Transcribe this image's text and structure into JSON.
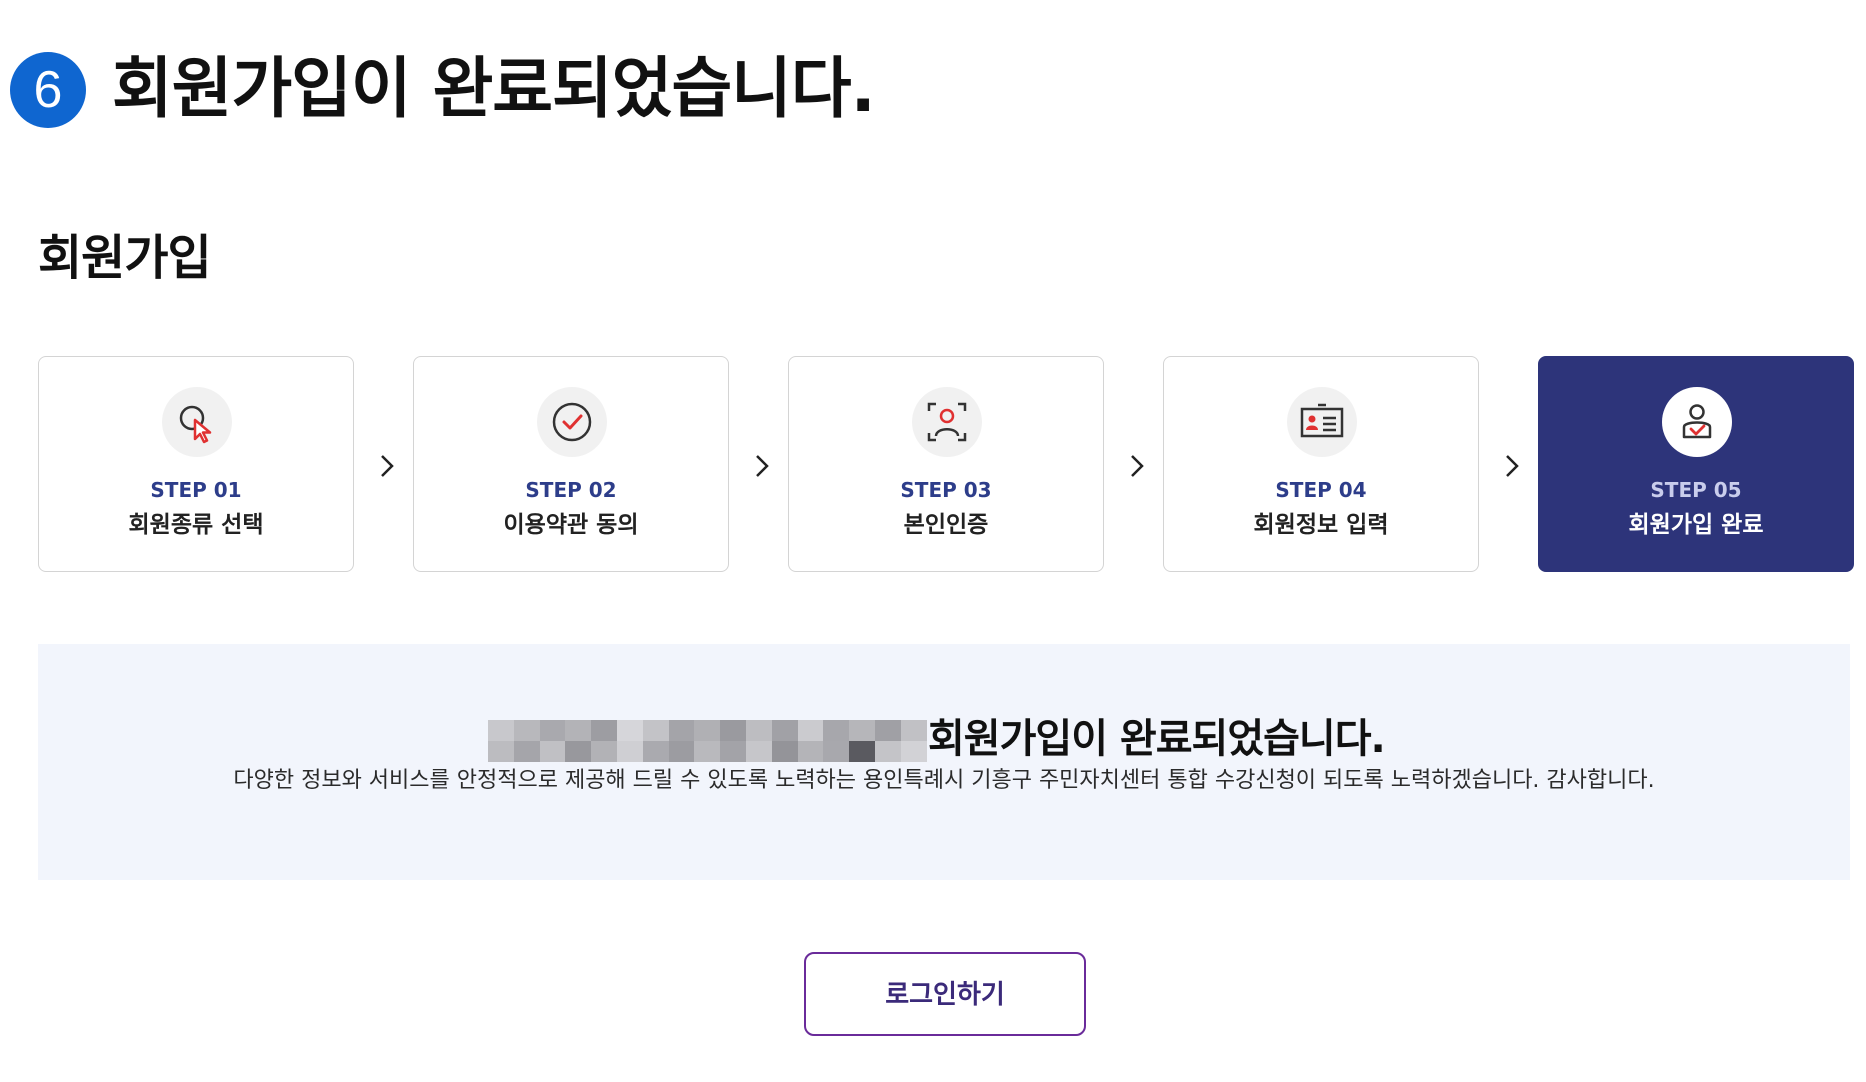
{
  "header": {
    "step_badge": "6",
    "title": "회원가입이 완료되었습니다."
  },
  "section": {
    "title": "회원가입"
  },
  "steps": [
    {
      "number": "STEP 01",
      "label": "회원종류 선택",
      "icon": "cursor-click-icon",
      "active": false
    },
    {
      "number": "STEP 02",
      "label": "이용약관 동의",
      "icon": "check-circle-icon",
      "active": false
    },
    {
      "number": "STEP 03",
      "label": "본인인증",
      "icon": "face-scan-icon",
      "active": false
    },
    {
      "number": "STEP 04",
      "label": "회원정보 입력",
      "icon": "id-card-icon",
      "active": false
    },
    {
      "number": "STEP 05",
      "label": "회원가입 완료",
      "icon": "user-check-icon",
      "active": true
    }
  ],
  "completion": {
    "title": "회원가입이 완료되었습니다.",
    "description": "다양한 정보와 서비스를 안정적으로 제공해 드릴 수 있도록 노력하는 용인특례시 기흥구 주민자치센터 통합 수강신청이 되도록 노력하겠습니다. 감사합니다."
  },
  "actions": {
    "login_label": "로그인하기"
  },
  "colors": {
    "badge": "#0f66d0",
    "active_step": "#2d347a",
    "step_number": "#2d3d8a",
    "panel_bg": "#f2f5fc",
    "button_border": "#6a2b9a",
    "icon_accent": "#e03131"
  }
}
